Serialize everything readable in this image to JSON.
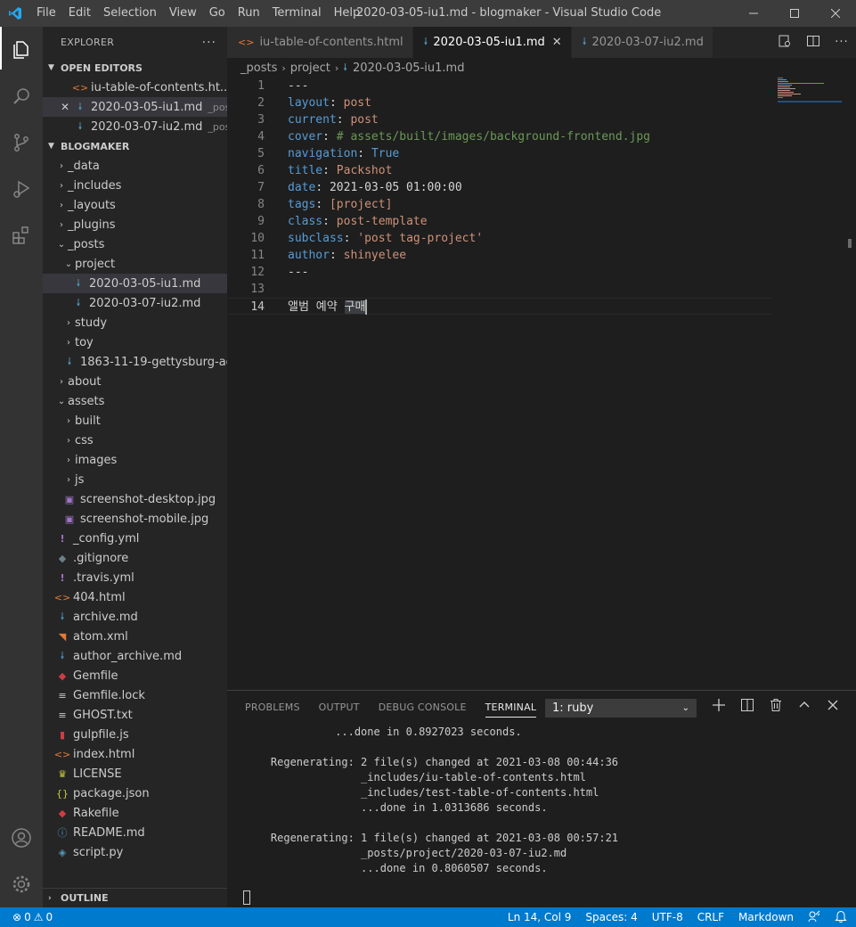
{
  "titlebar": {
    "menu": [
      "File",
      "Edit",
      "Selection",
      "View",
      "Go",
      "Run",
      "Terminal",
      "Help"
    ],
    "title": "2020-03-05-iu1.md - blogmaker - Visual Studio Code"
  },
  "sidebar": {
    "header": "EXPLORER",
    "open_editors_label": "OPEN EDITORS",
    "open_editors": [
      {
        "name": "iu-table-of-contents.ht...",
        "desc": ""
      },
      {
        "name": "2020-03-05-iu1.md",
        "desc": "_pos..."
      },
      {
        "name": "2020-03-07-iu2.md",
        "desc": "_pos..."
      }
    ],
    "project_label": "BLOGMAKER",
    "tree": [
      "_data",
      "_includes",
      "_layouts",
      "_plugins",
      "_posts",
      "project",
      "2020-03-05-iu1.md",
      "2020-03-07-iu2.md",
      "study",
      "toy",
      "1863-11-19-gettysburg-ad...",
      "about",
      "assets",
      "built",
      "css",
      "images",
      "js",
      "screenshot-desktop.jpg",
      "screenshot-mobile.jpg",
      "_config.yml",
      ".gitignore",
      ".travis.yml",
      "404.html",
      "archive.md",
      "atom.xml",
      "author_archive.md",
      "Gemfile",
      "Gemfile.lock",
      "GHOST.txt",
      "gulpfile.js",
      "index.html",
      "LICENSE",
      "package.json",
      "Rakefile",
      "README.md",
      "script.py"
    ],
    "outline_label": "OUTLINE"
  },
  "tabs": [
    {
      "label": "iu-table-of-contents.html"
    },
    {
      "label": "2020-03-05-iu1.md"
    },
    {
      "label": "2020-03-07-iu2.md"
    }
  ],
  "breadcrumb": [
    "_posts",
    "project",
    "2020-03-05-iu1.md"
  ],
  "editor": {
    "line_numbers": [
      "1",
      "2",
      "3",
      "4",
      "5",
      "6",
      "7",
      "8",
      "9",
      "10",
      "11",
      "12",
      "13",
      "14"
    ],
    "lines": [
      {
        "key": "---",
        "sep": "",
        "val": ""
      },
      {
        "key": "layout",
        "sep": ": ",
        "val": "post"
      },
      {
        "key": "current",
        "sep": ": ",
        "val": "post"
      },
      {
        "key": "cover",
        "sep": ": ",
        "val": "# assets/built/images/background-frontend.jpg"
      },
      {
        "key": "navigation",
        "sep": ": ",
        "val": "True"
      },
      {
        "key": "title",
        "sep": ": ",
        "val": "Packshot"
      },
      {
        "key": "date",
        "sep": ": ",
        "val": "2021-03-05 01:00:00"
      },
      {
        "key": "tags",
        "sep": ": ",
        "val": "[project]"
      },
      {
        "key": "class",
        "sep": ": ",
        "val": "post-template"
      },
      {
        "key": "subclass",
        "sep": ": ",
        "val": "'post tag-project'"
      },
      {
        "key": "author",
        "sep": ": ",
        "val": "shinyelee"
      },
      {
        "key": "---",
        "sep": "",
        "val": ""
      },
      {
        "key": "",
        "sep": "",
        "val": ""
      },
      {
        "key": "앨범 예약 ",
        "sep": "",
        "val": "구매"
      }
    ]
  },
  "panel": {
    "tabs": [
      "PROBLEMS",
      "OUTPUT",
      "DEBUG CONSOLE",
      "TERMINAL"
    ],
    "terminal_select": "1: ruby",
    "terminal_lines": [
      "              ...done in 0.8927023 seconds.",
      "",
      "    Regenerating: 2 file(s) changed at 2021-03-08 00:44:36",
      "                  _includes/iu-table-of-contents.html",
      "                  _includes/test-table-of-contents.html",
      "                  ...done in 1.0313686 seconds.",
      "",
      "    Regenerating: 1 file(s) changed at 2021-03-08 00:57:21",
      "                  _posts/project/2020-03-07-iu2.md",
      "                  ...done in 0.8060507 seconds."
    ]
  },
  "statusbar": {
    "errors": "0",
    "warnings": "0",
    "position": "Ln 14, Col 9",
    "spaces": "Spaces: 4",
    "encoding": "UTF-8",
    "eol": "CRLF",
    "language": "Markdown"
  },
  "colors": {
    "accent": "#007acc",
    "md_icon": "#519aba",
    "html_icon": "#e37933",
    "yaml_icon": "#a074c4",
    "keyword": "#569cd6",
    "string": "#ce9178",
    "comment": "#6a9955"
  }
}
